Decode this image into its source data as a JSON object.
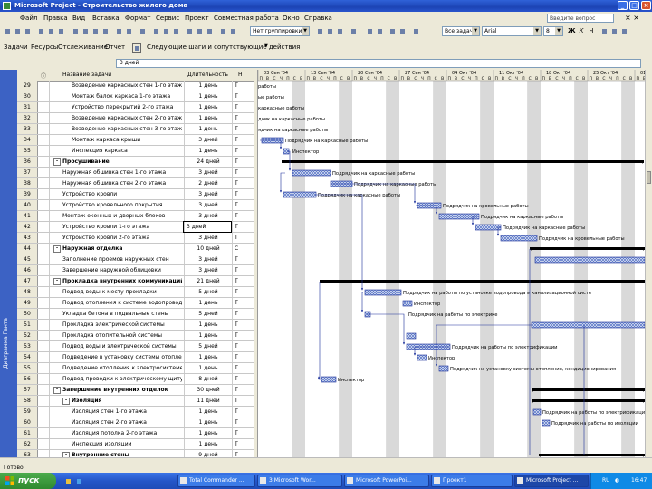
{
  "window": {
    "title": "Microsoft Project - Строительство жилого дома"
  },
  "menu": {
    "items": [
      "Файл",
      "Правка",
      "Вид",
      "Вставка",
      "Формат",
      "Сервис",
      "Проект",
      "Совместная работа",
      "Окно",
      "Справка"
    ],
    "help_placeholder": "Введите вопрос"
  },
  "toolbar": {
    "group_combo": "Нет группировки",
    "font_combo": "Arial",
    "size_combo": "8",
    "all_tasks": "Все задачи"
  },
  "project_guide": {
    "items": [
      "Задачи",
      "Ресурсы",
      "Отслеживание",
      "Отчет"
    ],
    "next": "Следующие шаги и сопутствующие действия"
  },
  "entry_bar": {
    "value": "3 дней"
  },
  "view_bar": {
    "label": "Диаграмма Ганта"
  },
  "table": {
    "headers": {
      "name": "Название задачи",
      "duration": "Длительность",
      "start": "Н"
    },
    "rows": [
      {
        "id": "29",
        "name": "Возведение каркасных стен 1-го этажа",
        "dur": "1 день",
        "start": "Т",
        "lvl": 3
      },
      {
        "id": "30",
        "name": "Монтаж балок каркаса 1-го этажа",
        "dur": "1 день",
        "start": "Т",
        "lvl": 3
      },
      {
        "id": "31",
        "name": "Устройство перекрытий 2-го этажа",
        "dur": "1 день",
        "start": "Т",
        "lvl": 3
      },
      {
        "id": "32",
        "name": "Возведение каркасных стен 2-го этажа",
        "dur": "1 день",
        "start": "Т",
        "lvl": 3
      },
      {
        "id": "33",
        "name": "Возведение каркасных стен 3-го этажа",
        "dur": "1 день",
        "start": "Т",
        "lvl": 3
      },
      {
        "id": "34",
        "name": "Монтаж каркаса крыши",
        "dur": "3 дней",
        "start": "Т",
        "lvl": 3
      },
      {
        "id": "35",
        "name": "Инспекция каркаса",
        "dur": "1 день",
        "start": "Т",
        "lvl": 3
      },
      {
        "id": "36",
        "name": "Просушивание",
        "dur": "24 дней",
        "start": "Т",
        "lvl": 1,
        "summary": true,
        "toggle": "-"
      },
      {
        "id": "37",
        "name": "Наружная обшивка стен 1-го этажа",
        "dur": "3 дней",
        "start": "Т",
        "lvl": 2
      },
      {
        "id": "38",
        "name": "Наружная обшивка стен 2-го этажа",
        "dur": "2 дней",
        "start": "Т",
        "lvl": 2
      },
      {
        "id": "39",
        "name": "Устройство кровли",
        "dur": "3 дней",
        "start": "Т",
        "lvl": 2
      },
      {
        "id": "40",
        "name": "Устройство кровельного покрытия",
        "dur": "3 дней",
        "start": "Т",
        "lvl": 2
      },
      {
        "id": "41",
        "name": "Монтаж оконных и дверных блоков",
        "dur": "3 дней",
        "start": "Т",
        "lvl": 2
      },
      {
        "id": "42",
        "name": "Устройство кровли 1-го этажа",
        "dur": "3 дней",
        "start": "Т",
        "lvl": 2,
        "sel": true
      },
      {
        "id": "43",
        "name": "Устройство кровли 2-го этажа",
        "dur": "3 дней",
        "start": "Т",
        "lvl": 2
      },
      {
        "id": "44",
        "name": "Наружная отделка",
        "dur": "10 дней",
        "start": "С",
        "lvl": 1,
        "summary": true,
        "toggle": "-"
      },
      {
        "id": "45",
        "name": "Заполнение проемов наружных стен",
        "dur": "3 дней",
        "start": "Т",
        "lvl": 2
      },
      {
        "id": "46",
        "name": "Завершение наружной облицовки",
        "dur": "3 дней",
        "start": "Т",
        "lvl": 2
      },
      {
        "id": "47",
        "name": "Прокладка внутренних коммуникаций",
        "dur": "21 дней",
        "start": "Т",
        "lvl": 1,
        "summary": true,
        "toggle": "-"
      },
      {
        "id": "48",
        "name": "Подвод воды к месту прокладки",
        "dur": "5 дней",
        "start": "Т",
        "lvl": 2
      },
      {
        "id": "49",
        "name": "Подвод отопления к системе водопровода",
        "dur": "1 день",
        "start": "Т",
        "lvl": 2
      },
      {
        "id": "50",
        "name": "Укладка бетона в подвальные стены",
        "dur": "5 дней",
        "start": "Т",
        "lvl": 2
      },
      {
        "id": "51",
        "name": "Прокладка электрической системы",
        "dur": "1 день",
        "start": "Т",
        "lvl": 2
      },
      {
        "id": "52",
        "name": "Прокладка отопительной системы",
        "dur": "1 день",
        "start": "Т",
        "lvl": 2
      },
      {
        "id": "53",
        "name": "Подвод воды и электрической системы",
        "dur": "5 дней",
        "start": "Т",
        "lvl": 2
      },
      {
        "id": "54",
        "name": "Подведение в установку системы отопления",
        "dur": "1 день",
        "start": "Т",
        "lvl": 2
      },
      {
        "id": "55",
        "name": "Подведение отопления к электросистеме",
        "dur": "1 день",
        "start": "Т",
        "lvl": 2
      },
      {
        "id": "56",
        "name": "Подвод проводки к электрическому щиту",
        "dur": "8 дней",
        "start": "Т",
        "lvl": 2
      },
      {
        "id": "57",
        "name": "Завершение внутренних отделок",
        "dur": "30 дней",
        "start": "Т",
        "lvl": 1,
        "summary": true,
        "toggle": "-"
      },
      {
        "id": "58",
        "name": "Изоляция",
        "dur": "11 дней",
        "start": "Т",
        "lvl": 2,
        "summary": true,
        "toggle": "-"
      },
      {
        "id": "59",
        "name": "Изоляция стен 1-го этажа",
        "dur": "1 день",
        "start": "Т",
        "lvl": 3
      },
      {
        "id": "60",
        "name": "Изоляция стен 2-го этажа",
        "dur": "1 день",
        "start": "Т",
        "lvl": 3
      },
      {
        "id": "61",
        "name": "Изоляция потолка 2-го этажа",
        "dur": "1 день",
        "start": "Т",
        "lvl": 3
      },
      {
        "id": "62",
        "name": "Инспекция изоляции",
        "dur": "1 день",
        "start": "Т",
        "lvl": 3
      },
      {
        "id": "63",
        "name": "Внутренние стены",
        "dur": "9 дней",
        "start": "Т",
        "lvl": 2,
        "summary": true,
        "toggle": "-"
      }
    ]
  },
  "timescale": {
    "weeks": [
      "03 Сен '04",
      "13 Сен '04",
      "20 Сен '04",
      "27 Сен '04",
      "04 Окт '04",
      "11 Окт '04",
      "18 Окт '04",
      "25 Окт '04",
      "01 Ноя '04"
    ],
    "days": "ПВСЧПСВ"
  },
  "gantt_labels": [
    "работы",
    "ые работы",
    "каркасные работы",
    "дчик на каркасные работы",
    "ядчик на каркасные работы",
    "Подрядчик на каркасные работы",
    "Инспектор",
    "Подрядчик на каркасные работы",
    "Подрядчик на каркасные работы",
    "Подрядчик на каркасные работы",
    "Подрядчик на кровельные работы",
    "Подрядчик на каркасные работы",
    "Подрядчик на каркасные работы",
    "Подрядчик на кровельные работы",
    "Подрядчик на работы по установке водопровода и канализационной систе",
    "Инспектор",
    "Подрядчик на работы по электрике",
    "Подрядчик на работы по электрификации",
    "Инспектор",
    "Подрядчик на установку системы отопления, кондиционирования",
    "Инспектор",
    "Подрядчик на работы по электрификации",
    "Подрядчик на работы по изоляции",
    "Подрядчик на работы по изоляции"
  ],
  "status": {
    "text": "Готово"
  },
  "taskbar": {
    "start": "пуск",
    "tasks": [
      "Total Commander ...",
      "3 Microsoft Wor...",
      "Microsoft PowerPoi...",
      "Проект1",
      "Microsoft Project ..."
    ],
    "lang": "RU",
    "clock": "16:47"
  },
  "colors": {
    "bar": "#1a2f9a",
    "bar_hatch": "#5b78c8",
    "summary": "#000000",
    "link": "#1a2f9a",
    "nonwork": "#d9d9d9"
  }
}
